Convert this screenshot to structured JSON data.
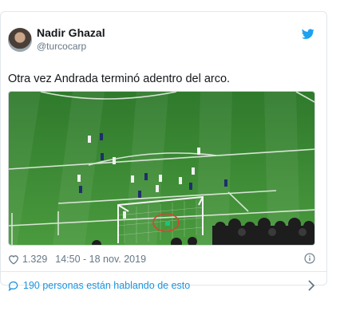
{
  "tweet": {
    "author_name": "Nadir Ghazal",
    "author_handle": "@turcocarp",
    "text": "Otra vez Andrada terminó adentro del arco.",
    "likes": "1.329",
    "timestamp": "14:50 - 18 nov. 2019",
    "conversation": "190 personas están hablando de esto"
  },
  "icons": {
    "bird": "twitter-bird-icon",
    "heart": "heart-icon",
    "info": "info-icon",
    "bubble": "speech-bubble-icon",
    "chevron": "chevron-right-icon"
  },
  "colors": {
    "brand": "#1da1f2",
    "link": "#1b95e0",
    "muted": "#657786",
    "pitch": "#3f8f3a",
    "annotation": "#d9442f"
  }
}
